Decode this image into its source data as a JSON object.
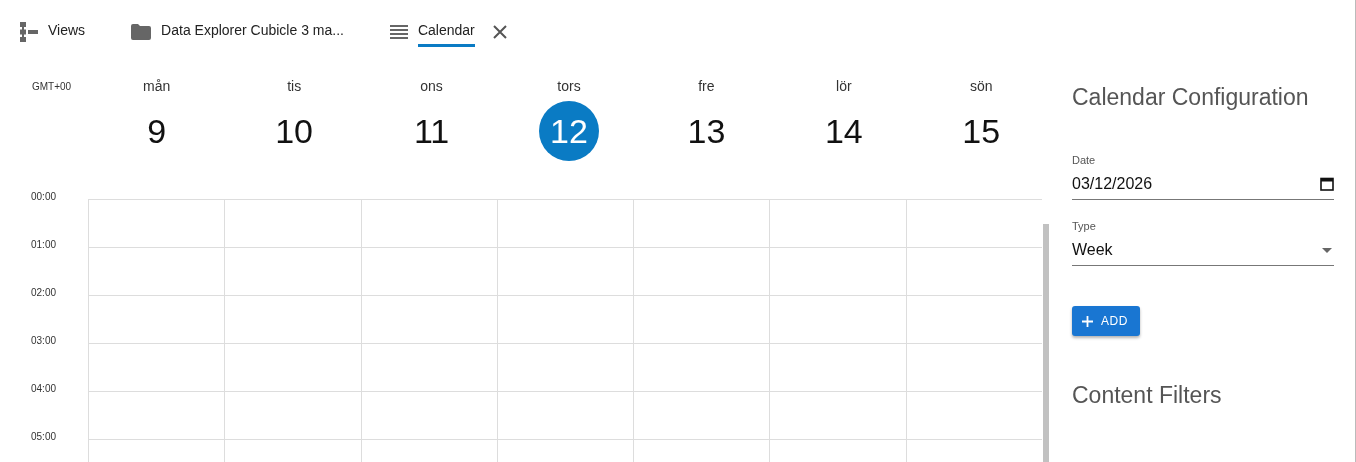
{
  "tabs": [
    {
      "label": "Views",
      "selected": false,
      "closable": false
    },
    {
      "label": "Data Explorer Cubicle 3 ma...",
      "selected": false,
      "closable": false
    },
    {
      "label": "Calendar",
      "selected": true,
      "closable": true
    }
  ],
  "calendar": {
    "timezone": "GMT+00",
    "days": [
      {
        "name": "mån",
        "date": "9",
        "selected": false
      },
      {
        "name": "tis",
        "date": "10",
        "selected": false
      },
      {
        "name": "ons",
        "date": "11",
        "selected": false
      },
      {
        "name": "tors",
        "date": "12",
        "selected": true
      },
      {
        "name": "fre",
        "date": "13",
        "selected": false
      },
      {
        "name": "lör",
        "date": "14",
        "selected": false
      },
      {
        "name": "sön",
        "date": "15",
        "selected": false
      }
    ],
    "hours": [
      "00:00",
      "01:00",
      "02:00",
      "03:00",
      "04:00",
      "05:00"
    ]
  },
  "config": {
    "title": "Calendar Configuration",
    "fields": [
      {
        "kind": "date",
        "label": "Date",
        "value": "03/12/2026"
      },
      {
        "kind": "select",
        "label": "Type",
        "value": "Week"
      }
    ],
    "add_button": "ADD",
    "filters_title": "Content Filters"
  }
}
